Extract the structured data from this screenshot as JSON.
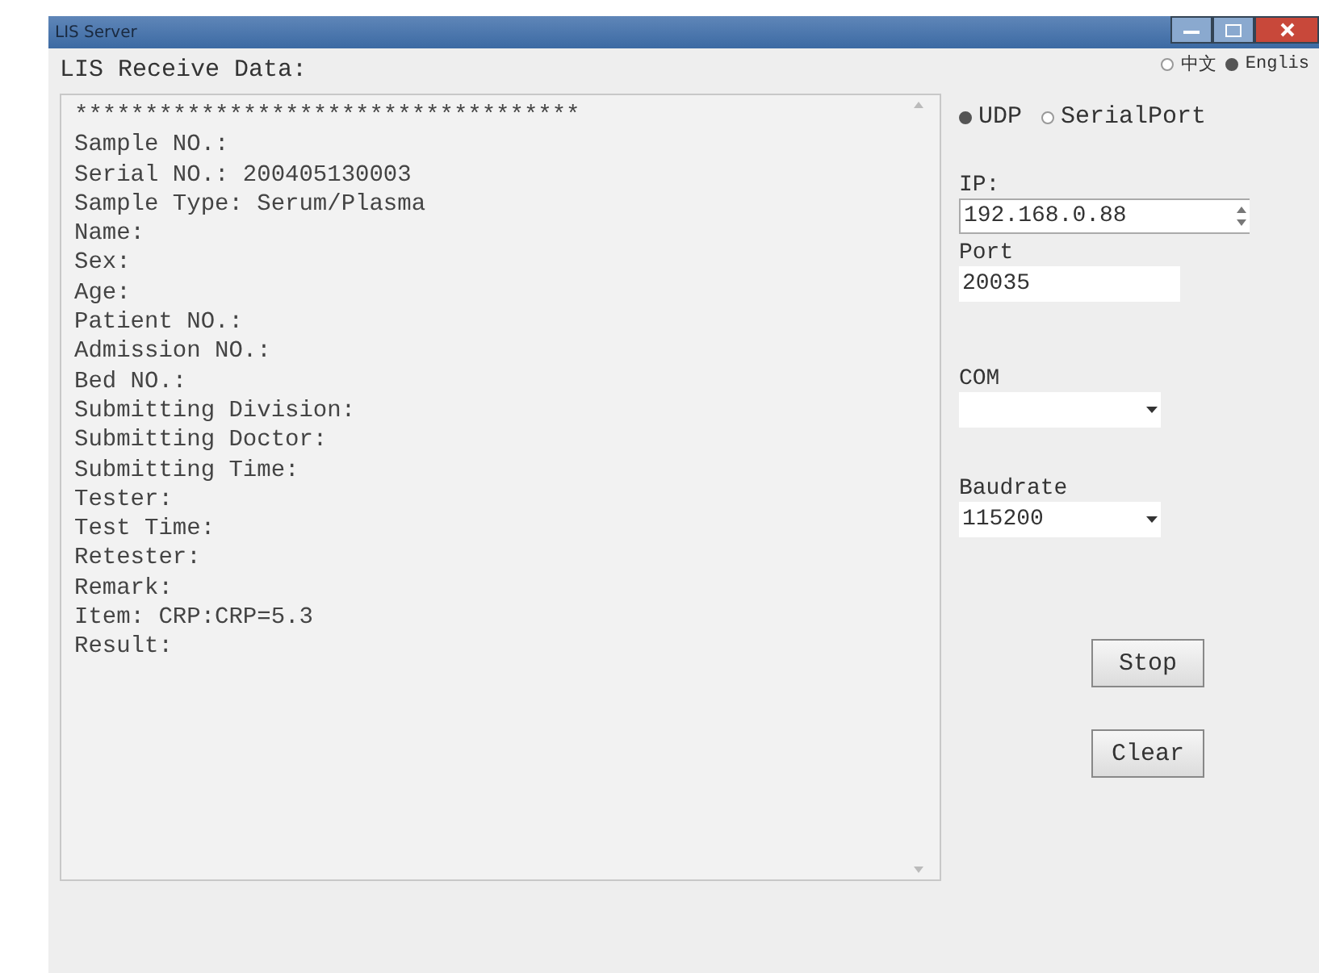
{
  "window": {
    "title": "LIS Server"
  },
  "language": [
    {
      "label": "中文",
      "selected": false
    },
    {
      "label": "Englis",
      "selected": true
    }
  ],
  "receive_label": "LIS Receive Data:",
  "log_lines": [
    "************************************",
    "Sample NO.:",
    "Serial NO.: 200405130003",
    "Sample Type: Serum/Plasma",
    "Name:",
    "Sex:",
    "Age:",
    "Patient NO.:",
    "Admission NO.:",
    "Bed NO.:",
    "Submitting Division:",
    "Submitting Doctor:",
    "Submitting Time:",
    "Tester:",
    "Test Time:",
    "Retester:",
    "Remark:",
    "Item: CRP:CRP=5.3",
    "Result:"
  ],
  "connection": [
    {
      "label": "UDP",
      "selected": true
    },
    {
      "label": "SerialPort",
      "selected": false
    }
  ],
  "ip": {
    "label": "IP:",
    "value": "192.168.0.88"
  },
  "port": {
    "label": "Port",
    "value": "20035"
  },
  "com": {
    "label": "COM"
  },
  "baudrate": {
    "label": "Baudrate",
    "value": "115200"
  },
  "buttons": [
    "Stop",
    "Clear"
  ]
}
